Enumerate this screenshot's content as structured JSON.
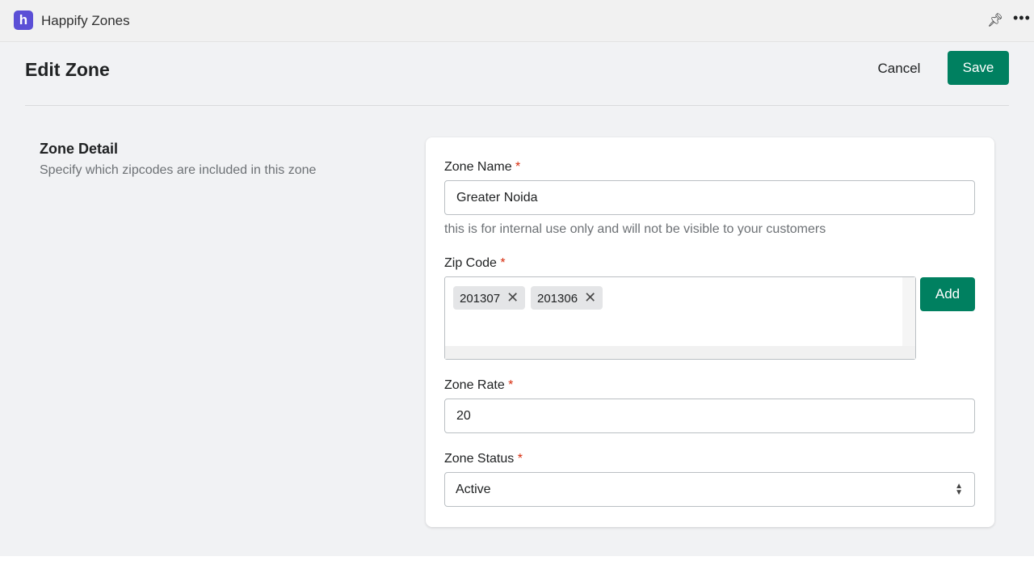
{
  "app": {
    "logo_letter": "h",
    "title": "Happify Zones",
    "pin_icon": "pin-icon",
    "more_icon": "more-icon"
  },
  "page": {
    "title": "Edit Zone",
    "cancel_label": "Cancel",
    "save_label": "Save"
  },
  "section": {
    "title": "Zone Detail",
    "description": "Specify which zipcodes are included in this zone"
  },
  "form": {
    "zone_name": {
      "label": "Zone Name",
      "required": "*",
      "value": "Greater Noida",
      "help": "this is for internal use only and will not be visible to your customers"
    },
    "zip_code": {
      "label": "Zip Code",
      "required": "*",
      "tags": [
        "201307",
        "201306"
      ],
      "add_label": "Add"
    },
    "zone_rate": {
      "label": "Zone Rate",
      "required": "*",
      "value": "20"
    },
    "zone_status": {
      "label": "Zone Status",
      "required": "*",
      "value": "Active"
    }
  },
  "colors": {
    "primary": "#008060",
    "logo": "#5b4fd6",
    "required": "#d72c0d"
  }
}
